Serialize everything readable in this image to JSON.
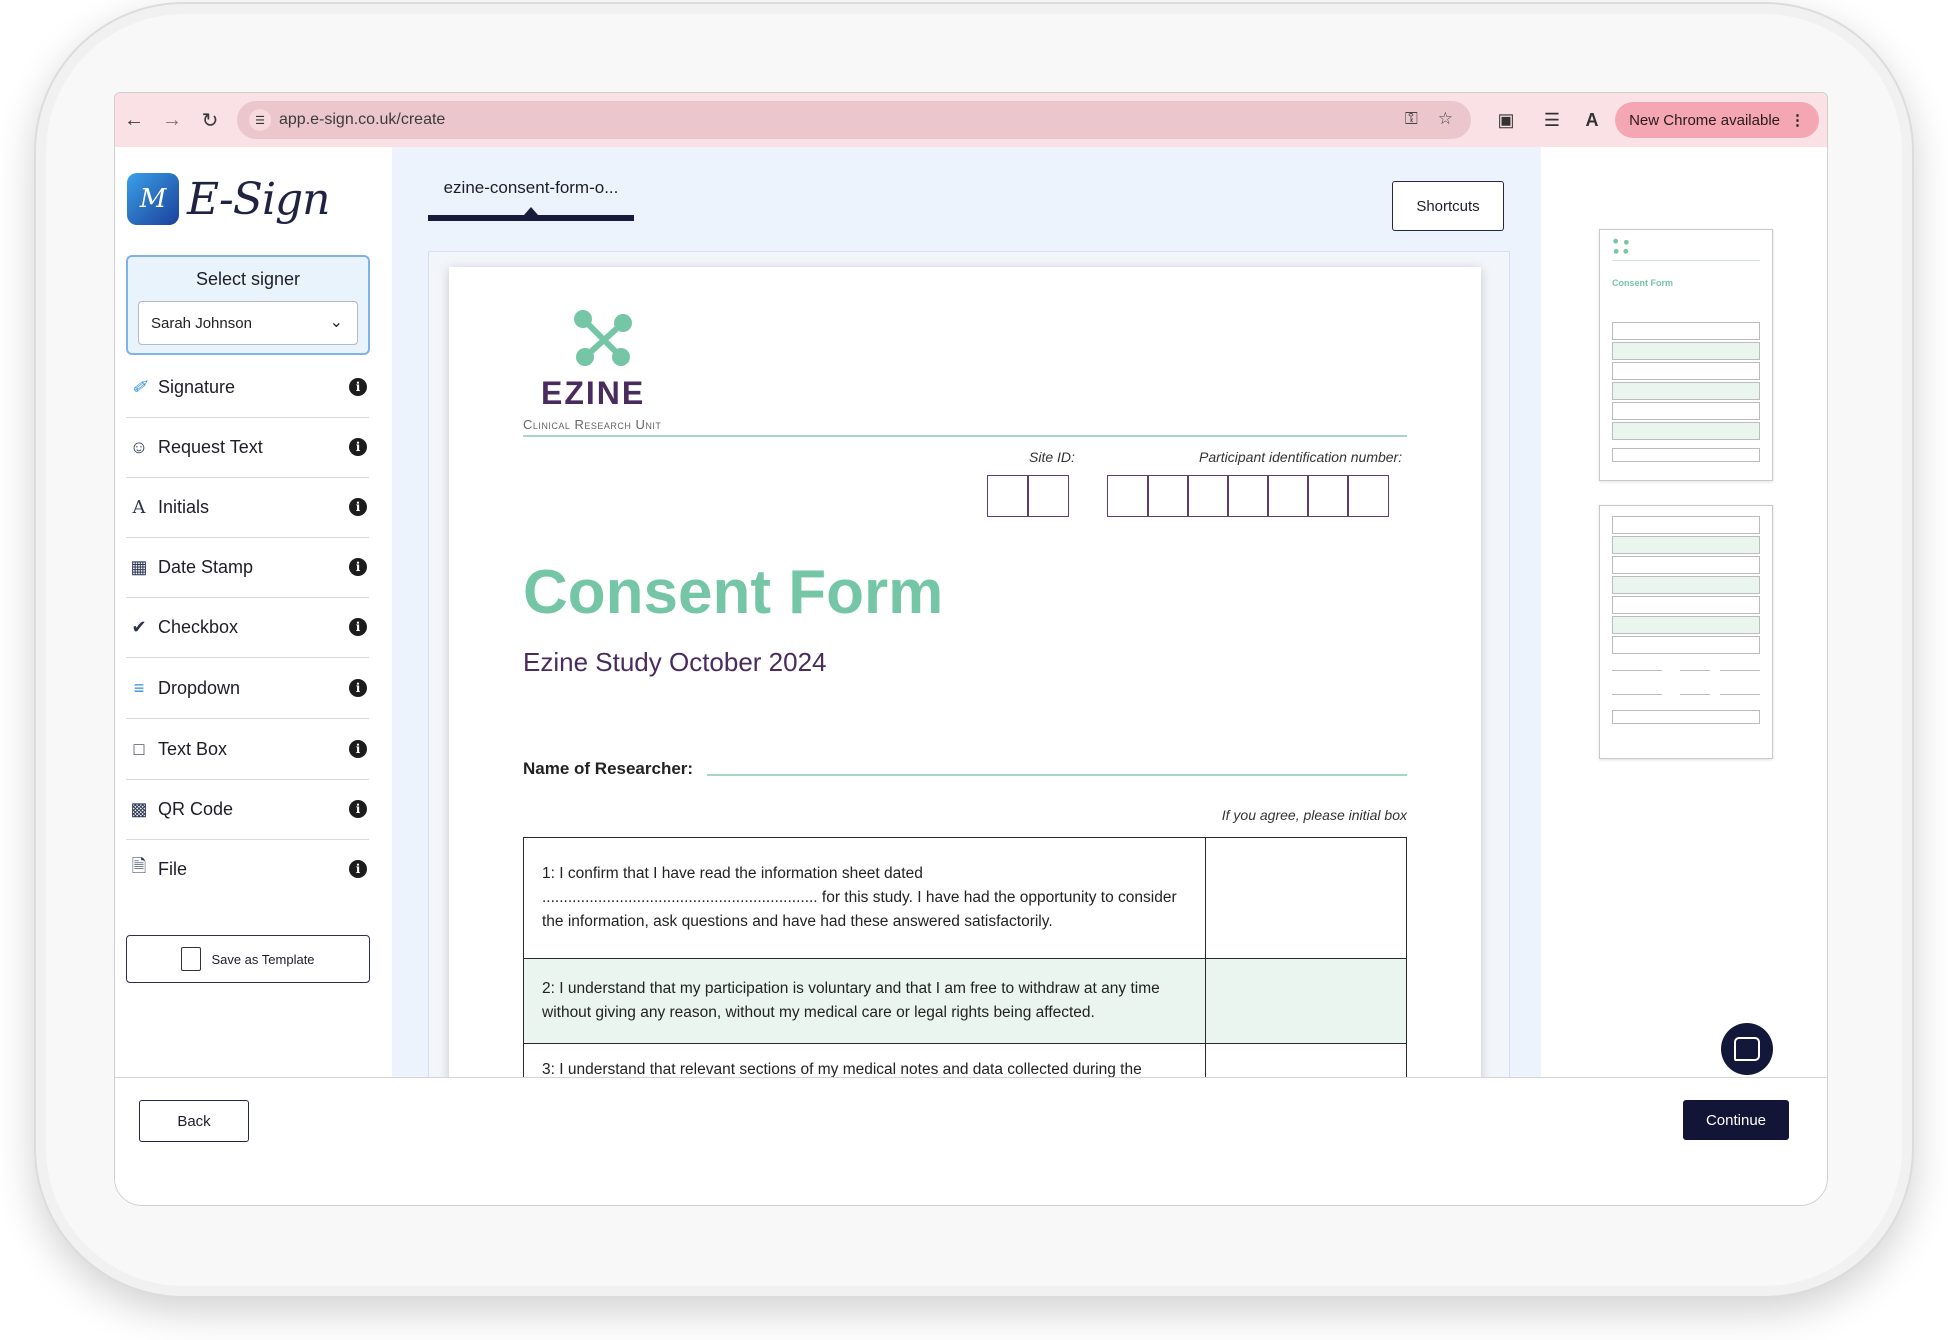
{
  "browser": {
    "url": "app.e-sign.co.uk/create",
    "new_chrome_label": "New Chrome available"
  },
  "app": {
    "logo_text": "E-Sign"
  },
  "signer": {
    "label": "Select signer",
    "selected": "Sarah Johnson"
  },
  "tools": [
    {
      "label": "Signature",
      "icon": "signature-icon"
    },
    {
      "label": "Request Text",
      "icon": "request-text-icon"
    },
    {
      "label": "Initials",
      "icon": "initials-icon"
    },
    {
      "label": "Date Stamp",
      "icon": "calendar-icon"
    },
    {
      "label": "Checkbox",
      "icon": "checkbox-icon"
    },
    {
      "label": "Dropdown",
      "icon": "dropdown-icon"
    },
    {
      "label": "Text Box",
      "icon": "text-box-icon"
    },
    {
      "label": "QR Code",
      "icon": "qr-code-icon"
    },
    {
      "label": "File",
      "icon": "file-icon"
    }
  ],
  "save_template_label": "Save as Template",
  "document": {
    "tab_label": "ezine-consent-form-o...",
    "shortcuts_label": "Shortcuts",
    "org_name": "EZINE",
    "org_sub": "Clinical Research Unit",
    "site_id_label": "Site ID:",
    "participant_label": "Participant identification number:",
    "title": "Consent Form",
    "subtitle": "Ezine Study October 2024",
    "researcher_label": "Name of Researcher:",
    "agree_hint": "If you agree, please initial box",
    "statements": [
      "1:   I confirm that I have read the information sheet dated ................................................................ for this study. I have had the opportunity to consider the information, ask questions and have had these answered satisfactorily.",
      "2:   I understand that my participation is voluntary and that I am free to withdraw at any time without giving any reason, without my medical care or legal rights being affected.",
      "3:   I understand that relevant sections of my medical notes and data collected during the"
    ],
    "brand_green": "#75c6a6",
    "brand_purple": "#4a2b5d"
  },
  "footer": {
    "back_label": "Back",
    "continue_label": "Continue"
  }
}
